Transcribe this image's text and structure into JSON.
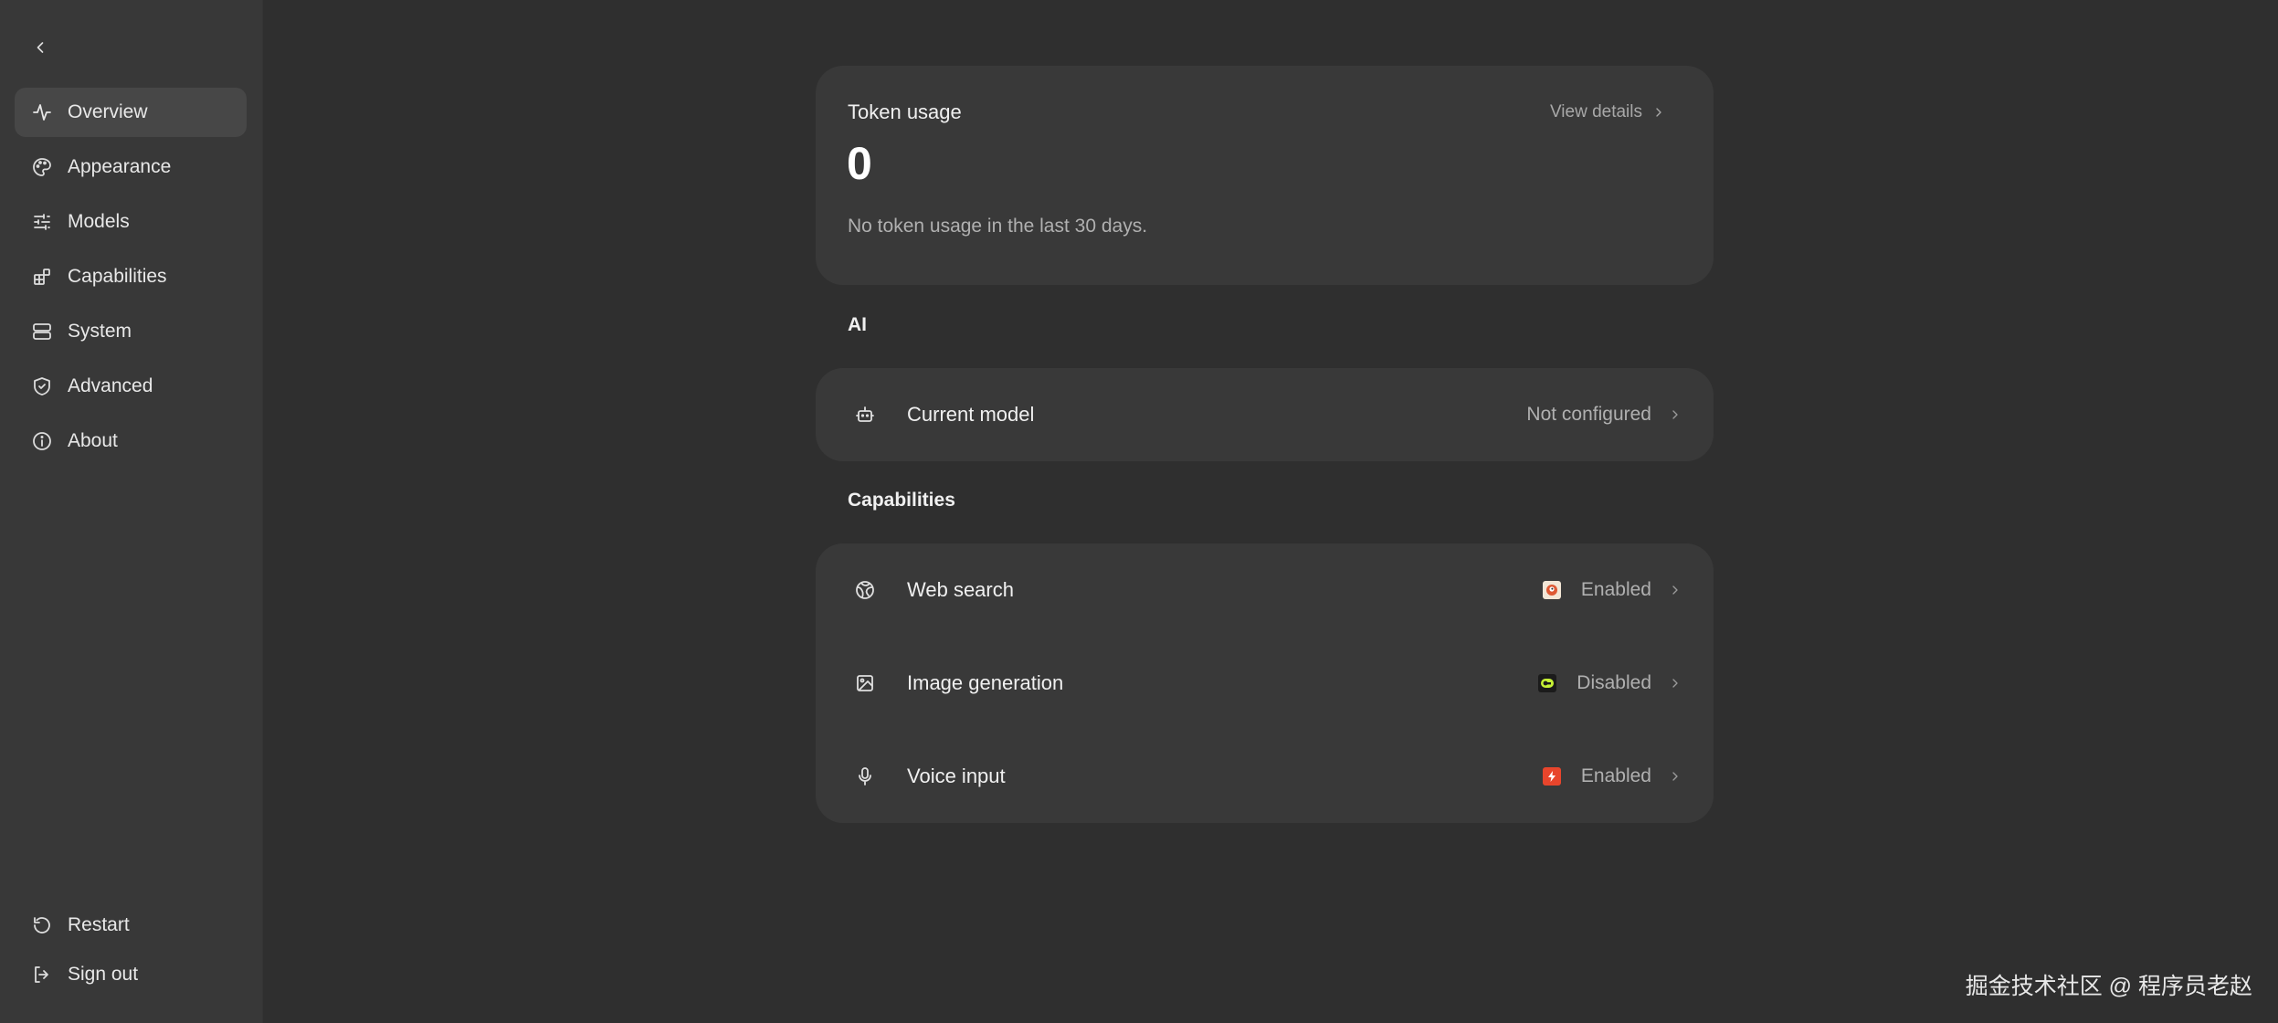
{
  "sidebar": {
    "items": [
      {
        "label": "Overview",
        "icon": "activity-icon",
        "active": true
      },
      {
        "label": "Appearance",
        "icon": "palette-icon"
      },
      {
        "label": "Models",
        "icon": "sliders-icon"
      },
      {
        "label": "Capabilities",
        "icon": "blocks-icon"
      },
      {
        "label": "System",
        "icon": "server-icon"
      },
      {
        "label": "Advanced",
        "icon": "shield-check-icon"
      },
      {
        "label": "About",
        "icon": "info-icon"
      }
    ],
    "bottom": [
      {
        "label": "Restart",
        "icon": "restart-icon"
      },
      {
        "label": "Sign out",
        "icon": "sign-out-icon"
      }
    ]
  },
  "token_usage": {
    "title": "Token usage",
    "value": "0",
    "description": "No token usage in the last 30 days.",
    "view_details": "View details"
  },
  "ai_section": {
    "title": "AI",
    "current_model": {
      "label": "Current model",
      "status": "Not configured",
      "icon": "bot-icon"
    }
  },
  "capabilities_section": {
    "title": "Capabilities",
    "rows": [
      {
        "label": "Web search",
        "status": "Enabled",
        "icon": "globe-icon",
        "badge_color": "#f3e6d6"
      },
      {
        "label": "Image generation",
        "status": "Disabled",
        "icon": "image-icon",
        "badge_color": "#1b1b1b"
      },
      {
        "label": "Voice input",
        "status": "Enabled",
        "icon": "microphone-icon",
        "badge_color": "#e8452c"
      }
    ]
  },
  "watermark": "掘金技术社区 @ 程序员老赵",
  "colors": {
    "background": "#2f2f2f",
    "sidebar": "#383838",
    "card": "#393939",
    "active_item": "#474747"
  }
}
